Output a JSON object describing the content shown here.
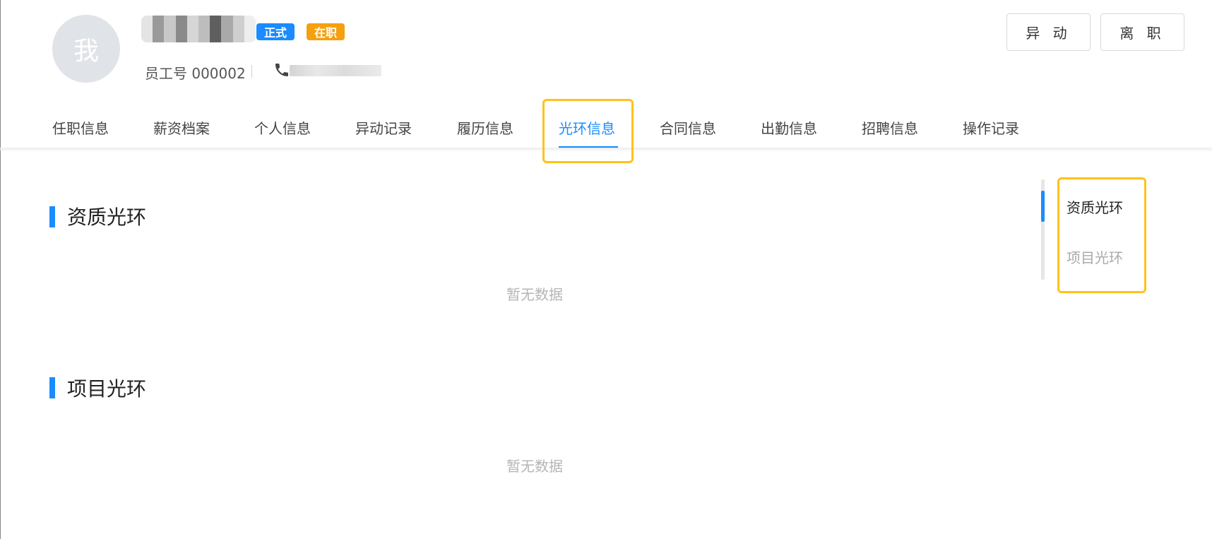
{
  "profile": {
    "avatar_text": "我",
    "tags": {
      "formal": "正式",
      "active": "在职"
    },
    "employee_no": "员工号 000002"
  },
  "actions": {
    "transfer": "异 动",
    "resign": "离 职"
  },
  "tabs": [
    {
      "label": "任职信息"
    },
    {
      "label": "薪资档案"
    },
    {
      "label": "个人信息"
    },
    {
      "label": "异动记录"
    },
    {
      "label": "履历信息"
    },
    {
      "label": "光环信息"
    },
    {
      "label": "合同信息"
    },
    {
      "label": "出勤信息"
    },
    {
      "label": "招聘信息"
    },
    {
      "label": "操作记录"
    }
  ],
  "active_tab": "光环信息",
  "sections": [
    {
      "title": "资质光环",
      "empty": "暂无数据"
    },
    {
      "title": "项目光环",
      "empty": "暂无数据"
    }
  ],
  "anchor_nav": {
    "items": [
      {
        "label": "资质光环"
      },
      {
        "label": "项目光环"
      }
    ],
    "active": "资质光环"
  },
  "colors": {
    "accent": "#1a8cff",
    "highlight": "#ffc21a",
    "tag_active": "#f5a00f"
  }
}
